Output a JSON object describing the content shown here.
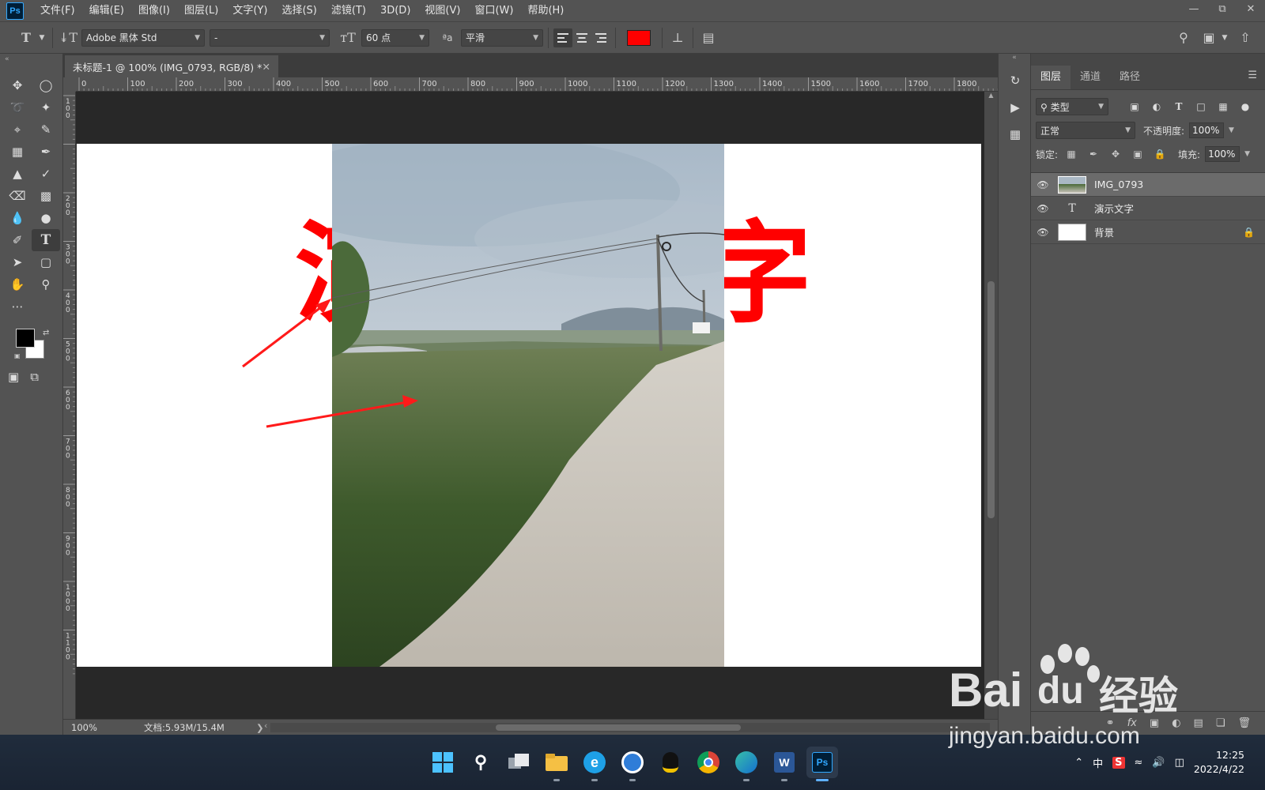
{
  "app": {
    "logo": "Ps",
    "menu": [
      "文件(F)",
      "编辑(E)",
      "图像(I)",
      "图层(L)",
      "文字(Y)",
      "选择(S)",
      "滤镜(T)",
      "3D(D)",
      "视图(V)",
      "窗口(W)",
      "帮助(H)"
    ],
    "window_controls": [
      "minimize-icon",
      "restore-icon",
      "close-icon"
    ]
  },
  "options": {
    "font_family": "Adobe 黑体 Std",
    "font_style": "-",
    "font_size": "60 点",
    "anti_alias_label": "ªa",
    "anti_alias": "平滑",
    "text_color": "#ff0000"
  },
  "toolbar": {
    "foreground_color": "#000000",
    "background_color": "#ffffff",
    "active_tool": "type-tool"
  },
  "document": {
    "tab_title": "未标题-1 @ 100% (IMG_0793, RGB/8) *",
    "ruler_h_labels": [
      "0",
      "100",
      "200",
      "300",
      "400",
      "500",
      "600",
      "700",
      "800",
      "900",
      "1000",
      "1100",
      "1200",
      "1300",
      "1400",
      "1500",
      "1600",
      "1700",
      "1800"
    ],
    "ruler_v_labels": [
      "100",
      "",
      "200",
      "300",
      "400",
      "500",
      "600",
      "700",
      "800",
      "900",
      "1000",
      "1100"
    ],
    "canvas_text_left": "演",
    "canvas_text_right": "字",
    "zoom": "100%",
    "doc_size": "文档:5.93M/15.4M"
  },
  "layers_panel": {
    "tabs": [
      "图层",
      "通道",
      "路径"
    ],
    "filter_kind": "类型",
    "blend_mode": "正常",
    "opacity_label": "不透明度:",
    "opacity": "100%",
    "lock_label": "锁定:",
    "fill_label": "填充:",
    "fill": "100%",
    "layers": [
      {
        "name": "IMG_0793",
        "kind": "image",
        "selected": true,
        "locked": false
      },
      {
        "name": "演示文字",
        "kind": "text",
        "selected": false,
        "locked": false
      },
      {
        "name": "背景",
        "kind": "background",
        "selected": false,
        "locked": true
      }
    ]
  },
  "taskbar": {
    "ime": "中",
    "time": "12:25",
    "date": "2022/4/22",
    "apps": [
      "windows-start-icon",
      "search-icon",
      "task-view-icon",
      "file-explorer-icon",
      "ie-browser-icon",
      "cloud-app-icon",
      "qq-icon",
      "chrome-icon",
      "edge-icon",
      "word-icon",
      "photoshop-icon"
    ]
  },
  "watermark": {
    "brand": "Bai",
    "brand_du": "du",
    "brand_cn": "经验",
    "url": "jingyan.baidu.com"
  }
}
